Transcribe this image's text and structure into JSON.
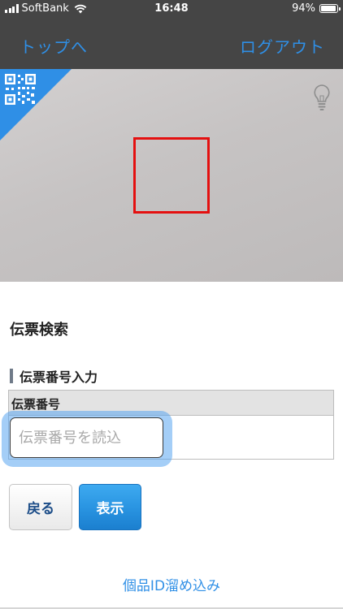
{
  "status_bar": {
    "carrier": "SoftBank",
    "time": "16:48",
    "battery_percent": "94%",
    "battery_level": 0.94,
    "signal_icon": "cell-signal-icon",
    "wifi_icon": "wifi-icon",
    "battery_icon": "battery-icon"
  },
  "nav": {
    "left_label": "トップへ",
    "right_label": "ログアウト",
    "link_color": "#2f8fe6"
  },
  "camera": {
    "qr_icon": "qr-code-icon",
    "light_icon": "lightbulb-icon",
    "frame_color": "#e41010",
    "corner_color": "#2f8fe6"
  },
  "search": {
    "title": "伝票検索",
    "section_title": "伝票番号入力",
    "field_label": "伝票番号",
    "input_value": "",
    "input_placeholder": "伝票番号を読込"
  },
  "buttons": {
    "back_label": "戻る",
    "show_label": "表示"
  },
  "footer": {
    "filter_link": "個品ID溜め込み"
  }
}
